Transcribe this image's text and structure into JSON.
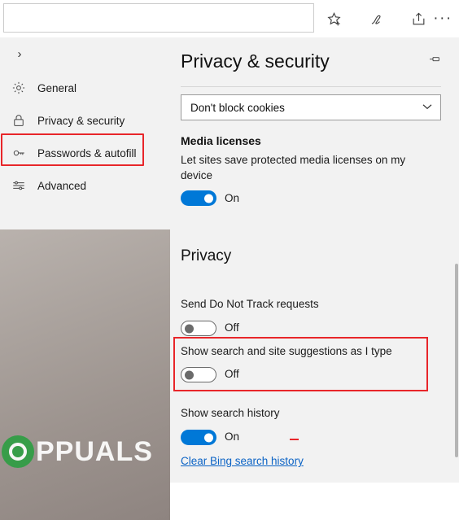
{
  "toolbar": {
    "address_value": "",
    "address_placeholder": "",
    "icons": [
      {
        "name": "favorites-star-icon",
        "label": "Add to favorites or reading list"
      },
      {
        "name": "web-note-pen-icon",
        "label": "Make a Web Note"
      },
      {
        "name": "share-icon",
        "label": "Share"
      },
      {
        "name": "more-icon",
        "label": "···"
      }
    ]
  },
  "sidebar": {
    "back_label": "›",
    "items": [
      {
        "label": "General",
        "icon": "gear-icon",
        "selected": false
      },
      {
        "label": "Privacy & security",
        "icon": "lock-icon",
        "selected": true
      },
      {
        "label": "Passwords & autofill",
        "icon": "key-icon",
        "selected": false
      },
      {
        "label": "Advanced",
        "icon": "sliders-icon",
        "selected": false
      }
    ]
  },
  "content": {
    "title": "Privacy & security",
    "pin_icon": "pin-icon",
    "cookies_select": {
      "value": "Don't block cookies",
      "chevron": "⌄"
    },
    "media_licenses": {
      "heading": "Media licenses",
      "description": "Let sites save protected media licenses on my device",
      "toggle_state": "On",
      "toggle_on": true
    },
    "privacy_heading": "Privacy",
    "do_not_track": {
      "label": "Send Do Not Track requests",
      "toggle_state": "Off",
      "toggle_on": false
    },
    "search_suggestions": {
      "label": "Show search and site suggestions as I type",
      "toggle_state": "Off",
      "toggle_on": false
    },
    "search_history": {
      "label": "Show search history",
      "toggle_state": "On",
      "toggle_on": true
    },
    "clear_history_link": "Clear Bing search history"
  },
  "watermark": {
    "text": "PPUALS",
    "url": "wsxdn.com"
  },
  "colors": {
    "accent": "#0078d7",
    "highlight": "#e8262a",
    "link": "#0b63c5",
    "panel": "#f2f2f2"
  }
}
